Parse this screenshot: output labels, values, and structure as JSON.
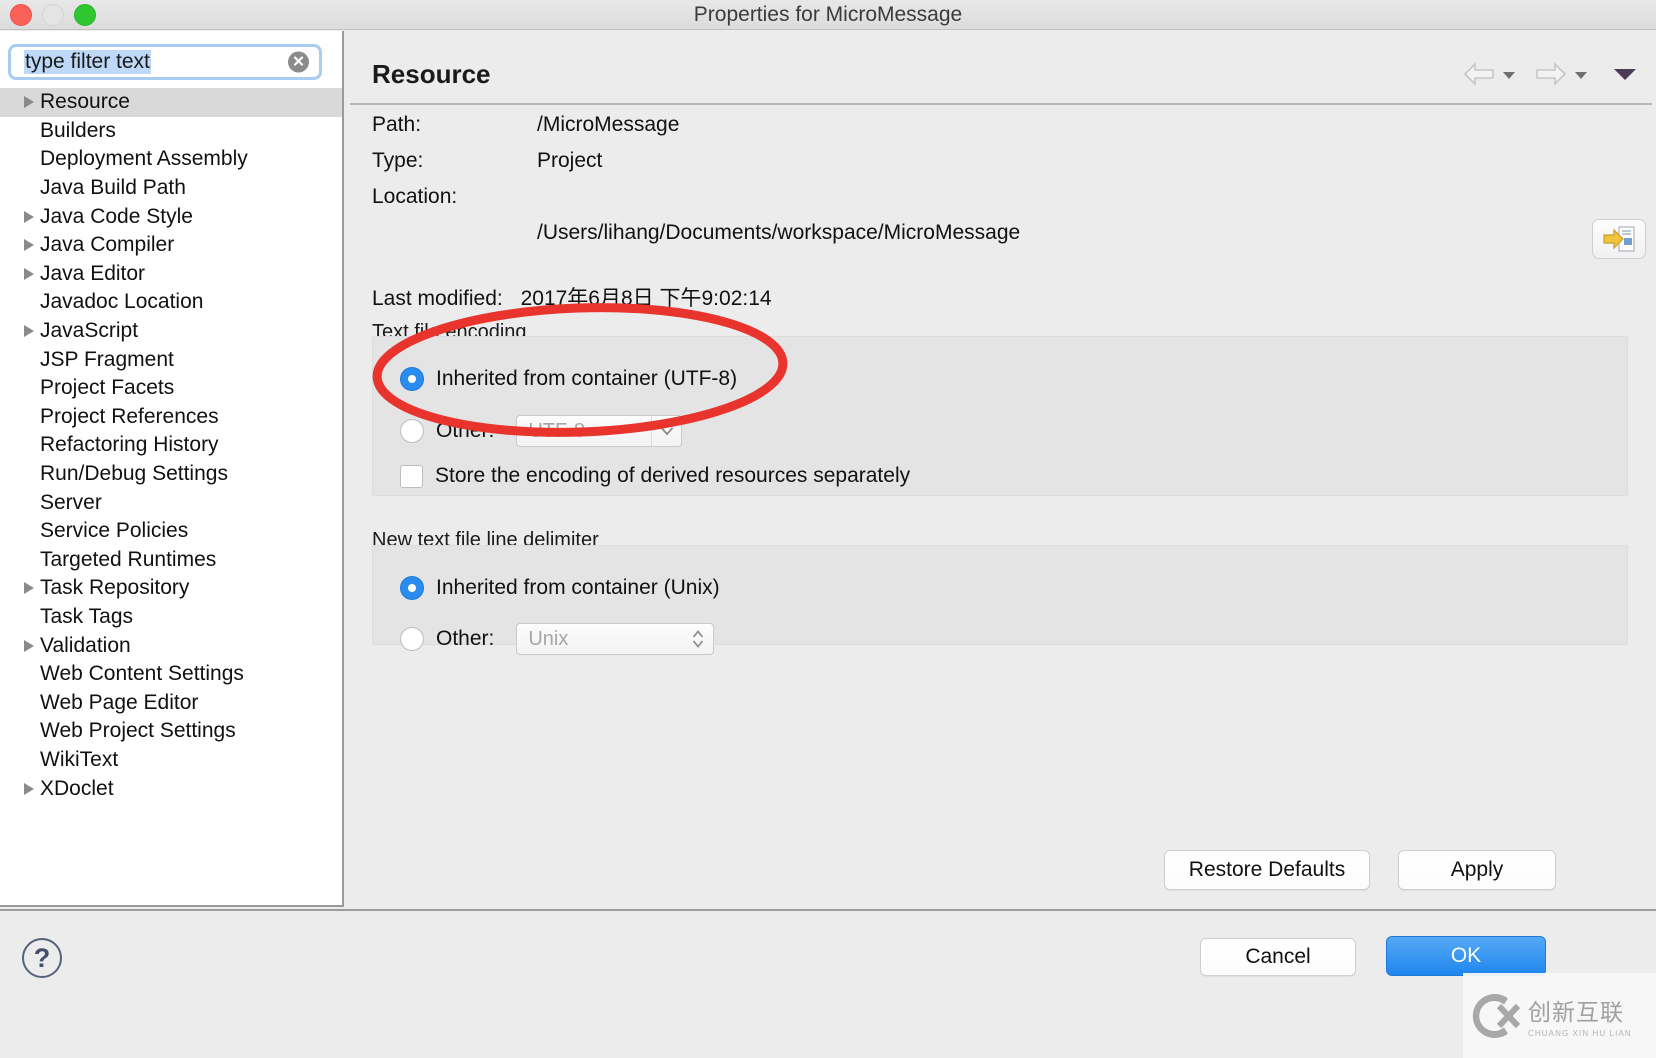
{
  "window": {
    "title": "Properties for MicroMessage",
    "traffic_lights": [
      "close",
      "minimize",
      "zoom"
    ]
  },
  "sidebar": {
    "filter": {
      "value": "type filter text",
      "placeholder": "type filter text",
      "clear_icon": "clear-circle-icon"
    },
    "items": [
      {
        "label": "Resource",
        "expandable": true,
        "selected": true
      },
      {
        "label": "Builders",
        "expandable": false,
        "selected": false
      },
      {
        "label": "Deployment Assembly",
        "expandable": false,
        "selected": false
      },
      {
        "label": "Java Build Path",
        "expandable": false,
        "selected": false
      },
      {
        "label": "Java Code Style",
        "expandable": true,
        "selected": false
      },
      {
        "label": "Java Compiler",
        "expandable": true,
        "selected": false
      },
      {
        "label": "Java Editor",
        "expandable": true,
        "selected": false
      },
      {
        "label": "Javadoc Location",
        "expandable": false,
        "selected": false
      },
      {
        "label": "JavaScript",
        "expandable": true,
        "selected": false
      },
      {
        "label": "JSP Fragment",
        "expandable": false,
        "selected": false
      },
      {
        "label": "Project Facets",
        "expandable": false,
        "selected": false
      },
      {
        "label": "Project References",
        "expandable": false,
        "selected": false
      },
      {
        "label": "Refactoring History",
        "expandable": false,
        "selected": false
      },
      {
        "label": "Run/Debug Settings",
        "expandable": false,
        "selected": false
      },
      {
        "label": "Server",
        "expandable": false,
        "selected": false
      },
      {
        "label": "Service Policies",
        "expandable": false,
        "selected": false
      },
      {
        "label": "Targeted Runtimes",
        "expandable": false,
        "selected": false
      },
      {
        "label": "Task Repository",
        "expandable": true,
        "selected": false
      },
      {
        "label": "Task Tags",
        "expandable": false,
        "selected": false
      },
      {
        "label": "Validation",
        "expandable": true,
        "selected": false
      },
      {
        "label": "Web Content Settings",
        "expandable": false,
        "selected": false
      },
      {
        "label": "Web Page Editor",
        "expandable": false,
        "selected": false
      },
      {
        "label": "Web Project Settings",
        "expandable": false,
        "selected": false
      },
      {
        "label": "WikiText",
        "expandable": false,
        "selected": false
      },
      {
        "label": "XDoclet",
        "expandable": true,
        "selected": false
      }
    ]
  },
  "main": {
    "page_title": "Resource",
    "nav": {
      "back_icon": "back-arrow-icon",
      "back_caret_icon": "chevron-down-icon",
      "forward_icon": "forward-arrow-icon",
      "forward_caret_icon": "chevron-down-icon",
      "menu_caret_icon": "chevron-down-icon"
    },
    "info": {
      "path_label": "Path:",
      "path_value": "/MicroMessage",
      "type_label": "Type:",
      "type_value": "Project",
      "location_label": "Location:",
      "location_value": "/Users/lihang/Documents/workspace/MicroMessage",
      "reveal_icon": "reveal-in-file-manager-icon",
      "last_modified_label": "Last modified:",
      "last_modified_value": "2017年6月8日 下午9:02:14"
    },
    "encoding_group": {
      "label": "Text file encoding",
      "inherited_label": "Inherited from container (UTF-8)",
      "inherited_selected": true,
      "other_label": "Other:",
      "other_selected": false,
      "other_value": "UTF-8",
      "other_dropdown_icon": "chevron-down-icon",
      "store_separately_label": "Store the encoding of derived resources separately",
      "store_separately_checked": false
    },
    "delimiter_group": {
      "label": "New text file line delimiter",
      "inherited_label": "Inherited from container (Unix)",
      "inherited_selected": true,
      "other_label": "Other:",
      "other_selected": false,
      "other_value": "Unix",
      "other_dropdown_icon": "stepper-updown-icon"
    },
    "restore_defaults_label": "Restore Defaults",
    "apply_label": "Apply"
  },
  "footer": {
    "help_icon": "help-question-icon",
    "help_glyph": "?",
    "cancel_label": "Cancel",
    "ok_label": "OK"
  },
  "annotation": {
    "shape": "ellipse-highlight",
    "color": "#e8342c"
  },
  "watermark": {
    "logo_icon": "circled-x-logo-icon",
    "main_text": "创新互联",
    "sub_text": "CHUANG XIN HU LIAN"
  },
  "colors": {
    "accent_blue": "#2b8cf0",
    "ok_button_blue": "#1f86ee",
    "annotation_red": "#e8342c",
    "window_bg": "#ececec",
    "tree_bg": "#ffffff",
    "selected_row": "#d9d9d9"
  }
}
